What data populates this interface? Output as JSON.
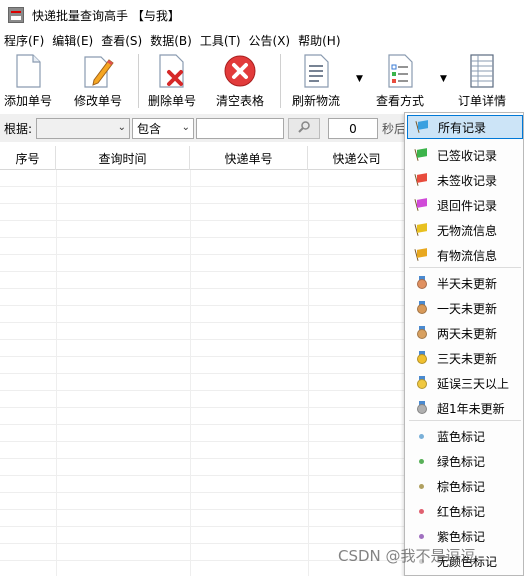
{
  "window": {
    "title": "快递批量查询高手 【与我】"
  },
  "menu": [
    "程序(F)",
    "编辑(E)",
    "查看(S)",
    "数据(B)",
    "工具(T)",
    "公告(X)",
    "帮助(H)"
  ],
  "toolbar": {
    "add": "添加单号",
    "edit": "修改单号",
    "delete": "删除单号",
    "clear": "清空表格",
    "refresh": "刷新物流",
    "view_mode": "查看方式",
    "order_detail": "订单详情"
  },
  "filter": {
    "label": "根据:",
    "field_value": "",
    "match_value": "包含",
    "keyword_value": "",
    "seconds_value": "0",
    "seconds_label": "秒后"
  },
  "table": {
    "columns": [
      "序号",
      "查询时间",
      "快递单号",
      "快递公司"
    ]
  },
  "dropdown": {
    "items": [
      {
        "label": "所有记录",
        "icon": "flag-icon",
        "color": "#3aa0e0",
        "selected": true
      },
      {
        "label": "已签收记录",
        "icon": "flag-icon",
        "color": "#3cb44b"
      },
      {
        "label": "未签收记录",
        "icon": "flag-icon",
        "color": "#e84c3d"
      },
      {
        "label": "退回件记录",
        "icon": "flag-icon",
        "color": "#d04ad8"
      },
      {
        "label": "无物流信息",
        "icon": "flag-icon",
        "color": "#e8c020"
      },
      {
        "label": "有物流信息",
        "icon": "flag-icon",
        "color": "#e8a820"
      },
      {
        "label": "半天未更新",
        "icon": "medal-icon",
        "color": "#e09060"
      },
      {
        "label": "一天未更新",
        "icon": "medal-icon",
        "color": "#d89a5a"
      },
      {
        "label": "两天未更新",
        "icon": "medal-icon",
        "color": "#d8a060"
      },
      {
        "label": "三天未更新",
        "icon": "medal-icon",
        "color": "#f0c030"
      },
      {
        "label": "延误三天以上",
        "icon": "medal-icon",
        "color": "#f0c840"
      },
      {
        "label": "超1年未更新",
        "icon": "medal-icon",
        "color": "#b0b0b0"
      },
      {
        "label": "蓝色标记",
        "icon": "dot-icon",
        "color": "#7ab0d8"
      },
      {
        "label": "绿色标记",
        "icon": "dot-icon",
        "color": "#58b058"
      },
      {
        "label": "棕色标记",
        "icon": "dot-icon",
        "color": "#b0a060"
      },
      {
        "label": "红色标记",
        "icon": "dot-icon",
        "color": "#e06070"
      },
      {
        "label": "紫色标记",
        "icon": "dot-icon",
        "color": "#a070c0"
      },
      {
        "label": "无颜色标记",
        "icon": "dot-icon",
        "color": "#d0d0d0"
      }
    ]
  },
  "watermark": "CSDN @我不是逗逗"
}
